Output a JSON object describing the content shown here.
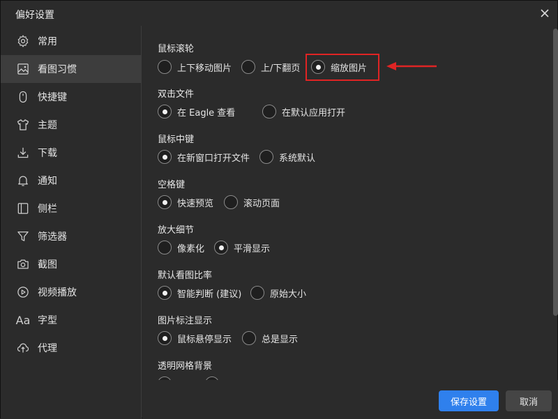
{
  "window": {
    "title": "偏好设置"
  },
  "sidebar": {
    "items": [
      {
        "label": "常用",
        "icon": "gear-icon"
      },
      {
        "label": "看图习惯",
        "icon": "image-icon"
      },
      {
        "label": "快捷键",
        "icon": "mouse-icon"
      },
      {
        "label": "主题",
        "icon": "shirt-icon"
      },
      {
        "label": "下载",
        "icon": "download-icon"
      },
      {
        "label": "通知",
        "icon": "bell-icon"
      },
      {
        "label": "侧栏",
        "icon": "sidebar-icon"
      },
      {
        "label": "筛选器",
        "icon": "filter-icon"
      },
      {
        "label": "截图",
        "icon": "camera-icon"
      },
      {
        "label": "视频播放",
        "icon": "play-icon"
      },
      {
        "label": "字型",
        "icon": "font-icon",
        "icon_text": "Aa"
      },
      {
        "label": "代理",
        "icon": "cloud-upload-icon"
      }
    ],
    "active_index": 1
  },
  "settings": {
    "groups": [
      {
        "label": "鼠标滚轮",
        "options": [
          "上下移动图片",
          "上/下翻页",
          "缩放图片"
        ],
        "selected": 2
      },
      {
        "label": "双击文件",
        "options": [
          "在 Eagle 查看",
          "在默认应用打开"
        ],
        "selected": 0
      },
      {
        "label": "鼠标中键",
        "options": [
          "在新窗口打开文件",
          "系统默认"
        ],
        "selected": 0
      },
      {
        "label": "空格键",
        "options": [
          "快速预览",
          "滚动页面"
        ],
        "selected": 0
      },
      {
        "label": "放大细节",
        "options": [
          "像素化",
          "平滑显示"
        ],
        "selected": 1
      },
      {
        "label": "默认看图比率",
        "options": [
          "智能判断 (建议)",
          "原始大小"
        ],
        "selected": 0
      },
      {
        "label": "图片标注显示",
        "options": [
          "鼠标悬停显示",
          "总是显示"
        ],
        "selected": 0
      },
      {
        "label": "透明网格背景",
        "options": [
          "",
          ""
        ],
        "selected": -1
      }
    ]
  },
  "footer": {
    "save_label": "保存设置",
    "cancel_label": "取消"
  },
  "colors": {
    "accent": "#2f80ed",
    "highlight": "#e02424",
    "background": "#2b2b2b",
    "active_item": "#3d3d3d"
  }
}
